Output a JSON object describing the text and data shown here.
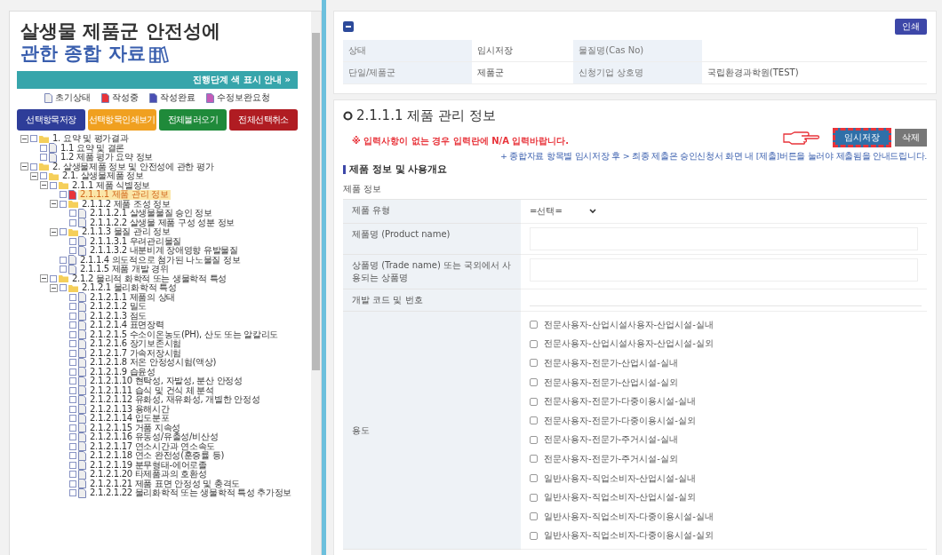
{
  "sidebar": {
    "title_line1": "살생물 제품군 안전성에",
    "title_line2": "관한 종합 자료",
    "progress_guide": "진행단계 색 표시 안내 »",
    "legend": [
      {
        "label": "초기상태",
        "color": "#eeeeee"
      },
      {
        "label": "작성중",
        "color": "#e8333a"
      },
      {
        "label": "작성완료",
        "color": "#4a4fb3"
      },
      {
        "label": "수정보완요청",
        "color": "#c45bb8"
      }
    ],
    "actions": [
      {
        "label": "선택항목저장",
        "color": "#2e3d99"
      },
      {
        "label": "선택항목인쇄보기",
        "color": "#f0a020"
      },
      {
        "label": "전체불러오기",
        "color": "#1f8a3a"
      },
      {
        "label": "전체선택취소",
        "color": "#b01c22"
      }
    ],
    "tree": [
      {
        "kind": "folder",
        "label": "1. 요약 및 평가결과",
        "checked": false,
        "expanded": true,
        "children": [
          {
            "kind": "page",
            "label": "1.1 요약 및 결론",
            "checked": false,
            "color": "#eeeeee",
            "selected": false
          },
          {
            "kind": "page",
            "label": "1.2 제품 평가 요약 정보",
            "checked": false,
            "color": "#eeeeee",
            "selected": false
          }
        ]
      },
      {
        "kind": "folder",
        "label": "2. 살생물제품 정보 및 안전성에 관한 평가",
        "checked": false,
        "expanded": true,
        "children": [
          {
            "kind": "folder",
            "label": "2.1. 살생물제품 정보",
            "checked": false,
            "expanded": true,
            "children": [
              {
                "kind": "folder",
                "label": "2.1.1 제품 식별정보",
                "checked": false,
                "expanded": true,
                "children": [
                  {
                    "kind": "page",
                    "label": "2.1.1.1 제품 관리 정보",
                    "checked": false,
                    "color": "#e8333a",
                    "selected": true
                  },
                  {
                    "kind": "folder",
                    "label": "2.1.1.2 제품 조성 정보",
                    "checked": false,
                    "expanded": true,
                    "children": [
                      {
                        "kind": "page",
                        "label": "2.1.1.2.1 살생물물질 승인 정보",
                        "checked": false,
                        "color": "#eeeeee",
                        "selected": false
                      },
                      {
                        "kind": "page",
                        "label": "2.1.1.2.2 살생물 제품 구성 성분 정보",
                        "checked": false,
                        "color": "#eeeeee",
                        "selected": false
                      }
                    ]
                  },
                  {
                    "kind": "folder",
                    "label": "2.1.1.3 물질 관리 정보",
                    "checked": false,
                    "expanded": true,
                    "children": [
                      {
                        "kind": "page",
                        "label": "2.1.1.3.1 우려관리물질",
                        "checked": false,
                        "color": "#eeeeee",
                        "selected": false
                      },
                      {
                        "kind": "page",
                        "label": "2.1.1.3.2 내분비계 장애영향 유발물질",
                        "checked": false,
                        "color": "#eeeeee",
                        "selected": false
                      }
                    ]
                  },
                  {
                    "kind": "page",
                    "label": "2.1.1.4 의도적으로 첨가된 나노물질 정보",
                    "checked": false,
                    "color": "#eeeeee",
                    "selected": false
                  },
                  {
                    "kind": "page",
                    "label": "2.1.1.5 제품 개발 경위",
                    "checked": false,
                    "color": "#eeeeee",
                    "selected": false
                  }
                ]
              },
              {
                "kind": "folder",
                "label": "2.1.2 물리적 화학적 또는 생물학적 특성",
                "checked": false,
                "expanded": true,
                "children": [
                  {
                    "kind": "folder",
                    "label": "2.1.2.1 물리화학적 특성",
                    "checked": false,
                    "expanded": true,
                    "children": [
                      {
                        "kind": "page",
                        "label": "2.1.2.1.1 제품의 상태",
                        "checked": false,
                        "color": "#eeeeee",
                        "selected": false
                      },
                      {
                        "kind": "page",
                        "label": "2.1.2.1.2 밀도",
                        "checked": false,
                        "color": "#eeeeee",
                        "selected": false
                      },
                      {
                        "kind": "page",
                        "label": "2.1.2.1.3 점도",
                        "checked": false,
                        "color": "#eeeeee",
                        "selected": false
                      },
                      {
                        "kind": "page",
                        "label": "2.1.2.1.4 표면장력",
                        "checked": false,
                        "color": "#eeeeee",
                        "selected": false
                      },
                      {
                        "kind": "page",
                        "label": "2.1.2.1.5 수소이온농도(PH), 산도 또는 알칼리도",
                        "checked": false,
                        "color": "#eeeeee",
                        "selected": false
                      },
                      {
                        "kind": "page",
                        "label": "2.1.2.1.6 장기보존시험",
                        "checked": false,
                        "color": "#eeeeee",
                        "selected": false
                      },
                      {
                        "kind": "page",
                        "label": "2.1.2.1.7 가속저장시험",
                        "checked": false,
                        "color": "#eeeeee",
                        "selected": false
                      },
                      {
                        "kind": "page",
                        "label": "2.1.2.1.8 저온 안정성시험(액상)",
                        "checked": false,
                        "color": "#eeeeee",
                        "selected": false
                      },
                      {
                        "kind": "page",
                        "label": "2.1.2.1.9 습윤성",
                        "checked": false,
                        "color": "#eeeeee",
                        "selected": false
                      },
                      {
                        "kind": "page",
                        "label": "2.1.2.1.10 현탁성, 자발성, 분산 안정성",
                        "checked": false,
                        "color": "#eeeeee",
                        "selected": false
                      },
                      {
                        "kind": "page",
                        "label": "2.1.2.1.11 습식 및 건식 체 분석",
                        "checked": false,
                        "color": "#eeeeee",
                        "selected": false
                      },
                      {
                        "kind": "page",
                        "label": "2.1.2.1.12 유화성, 재유화성, 개별한 안정성",
                        "checked": false,
                        "color": "#eeeeee",
                        "selected": false
                      },
                      {
                        "kind": "page",
                        "label": "2.1.2.1.13 용해시간",
                        "checked": false,
                        "color": "#eeeeee",
                        "selected": false
                      },
                      {
                        "kind": "page",
                        "label": "2.1.2.1.14 입도분포",
                        "checked": false,
                        "color": "#eeeeee",
                        "selected": false
                      },
                      {
                        "kind": "page",
                        "label": "2.1.2.1.15 거품 지속성",
                        "checked": false,
                        "color": "#eeeeee",
                        "selected": false
                      },
                      {
                        "kind": "page",
                        "label": "2.1.2.1.16 유동성/유출성/비산성",
                        "checked": false,
                        "color": "#eeeeee",
                        "selected": false
                      },
                      {
                        "kind": "page",
                        "label": "2.1.2.1.17 연소시간과 연소속도",
                        "checked": false,
                        "color": "#eeeeee",
                        "selected": false
                      },
                      {
                        "kind": "page",
                        "label": "2.1.2.1.18 연소 완전성(훈증률 등)",
                        "checked": false,
                        "color": "#eeeeee",
                        "selected": false
                      },
                      {
                        "kind": "page",
                        "label": "2.1.2.1.19 분무형태-에어로졸",
                        "checked": false,
                        "color": "#eeeeee",
                        "selected": false
                      },
                      {
                        "kind": "page",
                        "label": "2.1.2.1.20 타제품과의 호환성",
                        "checked": false,
                        "color": "#eeeeee",
                        "selected": false
                      },
                      {
                        "kind": "page",
                        "label": "2.1.2.1.21 제품 표면 안정성 및 충격도",
                        "checked": false,
                        "color": "#eeeeee",
                        "selected": false
                      },
                      {
                        "kind": "page",
                        "label": "2.1.2.1.22 물리화학적 또는 생물학적 특성 추가정보",
                        "checked": false,
                        "color": "#eeeeee",
                        "selected": false
                      }
                    ]
                  }
                ]
              }
            ]
          }
        ]
      }
    ]
  },
  "summary": {
    "print_button": "인쇄",
    "rows": [
      [
        {
          "label": "상태",
          "value": "임시저장"
        },
        {
          "label": "물질명(Cas No)"
        }
      ],
      [
        {
          "label": "단일/제품군",
          "value": "제품군"
        },
        {
          "label": "신청기업 상호명",
          "value": "국립환경과학원(TEST)"
        }
      ]
    ]
  },
  "section": {
    "title": "2.1.1.1 제품 관리 정보",
    "notice": "※ 입력사항이 없는 경우 입력란에 N/A 입력바랍니다.",
    "save_button": {
      "label": "임시저장",
      "highlighted": true
    },
    "delete_button": "삭제",
    "save_note": "+ 종합자료 항목별 임시저장 후 > 최종 제출은 승인신청서 화면 내 [제출]버튼을 눌러야 제출됨을 안내드립니다.",
    "subheading": "제품 정보 및 사용개요",
    "group_label": "제품 정보",
    "fields": [
      {
        "kind": "select",
        "label": "제품 유형",
        "value": "=선택="
      },
      {
        "kind": "text",
        "label": "제품명 (Product name)"
      },
      {
        "kind": "text",
        "label": "상품명 (Trade name) 또는 국외에서 사용되는 상품명"
      },
      {
        "kind": "line",
        "label": "개발 코드 및 번호"
      },
      {
        "kind": "checklist",
        "label": "용도",
        "options": [
          {
            "label": "전문사용자-산업시설사용자-산업시설-실내",
            "checked": false
          },
          {
            "label": "전문사용자-산업시설사용자-산업시설-실외",
            "checked": false
          },
          {
            "label": "전문사용자-전문가-산업시설-실내",
            "checked": false
          },
          {
            "label": "전문사용자-전문가-산업시설-실외",
            "checked": false
          },
          {
            "label": "전문사용자-전문가-다중이용시설-실내",
            "checked": false
          },
          {
            "label": "전문사용자-전문가-다중이용시설-실외",
            "checked": false
          },
          {
            "label": "전문사용자-전문가-주거시설-실내",
            "checked": false
          },
          {
            "label": "전문사용자-전문가-주거시설-실외",
            "checked": false
          },
          {
            "label": "일반사용자-직업소비자-산업시설-실내",
            "checked": false
          },
          {
            "label": "일반사용자-직업소비자-산업시설-실외",
            "checked": false
          },
          {
            "label": "일반사용자-직업소비자-다중이용시설-실내",
            "checked": false
          },
          {
            "label": "일반사용자-직업소비자-다중이용시설-실외",
            "checked": false
          }
        ]
      }
    ]
  }
}
